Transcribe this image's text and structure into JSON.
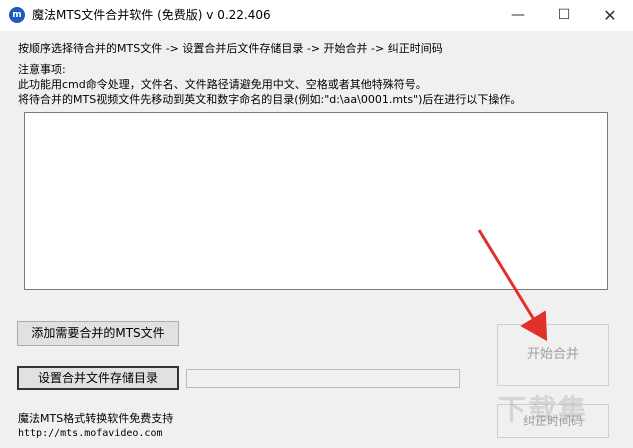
{
  "window": {
    "title": "魔法MTS文件合并软件 (免费版) v 0.22.406",
    "app_icon_glyph": "m",
    "minimize_glyph": "—",
    "maximize_glyph": "☐",
    "close_glyph": "✕"
  },
  "instructions": {
    "steps": "按顺序选择待合并的MTS文件 -> 设置合并后文件存储目录  -> 开始合并 -> 纠正时间码",
    "notes_title": "注意事项:",
    "note_1": "此功能用cmd命令处理，文件名、文件路径请避免用中文、空格或者其他特殊符号。",
    "note_2": "将待合并的MTS视频文件先移动到英文和数字命名的目录(例如:\"d:\\aa\\0001.mts\")后在进行以下操作。"
  },
  "buttons": {
    "add_files": "添加需要合并的MTS文件",
    "set_output_dir": "设置合并文件存储目录",
    "start_merge": "开始合并",
    "fix_timecode": "纠正时间码"
  },
  "output_dir": {
    "value": ""
  },
  "footer": {
    "support_text": "魔法MTS格式转换软件免费支持",
    "support_link": "http://mts.mofavideo.com"
  },
  "watermark": {
    "text": "下载集"
  },
  "colors": {
    "annotation_arrow": "#e0322a",
    "app_icon": "#1e5bbf"
  }
}
